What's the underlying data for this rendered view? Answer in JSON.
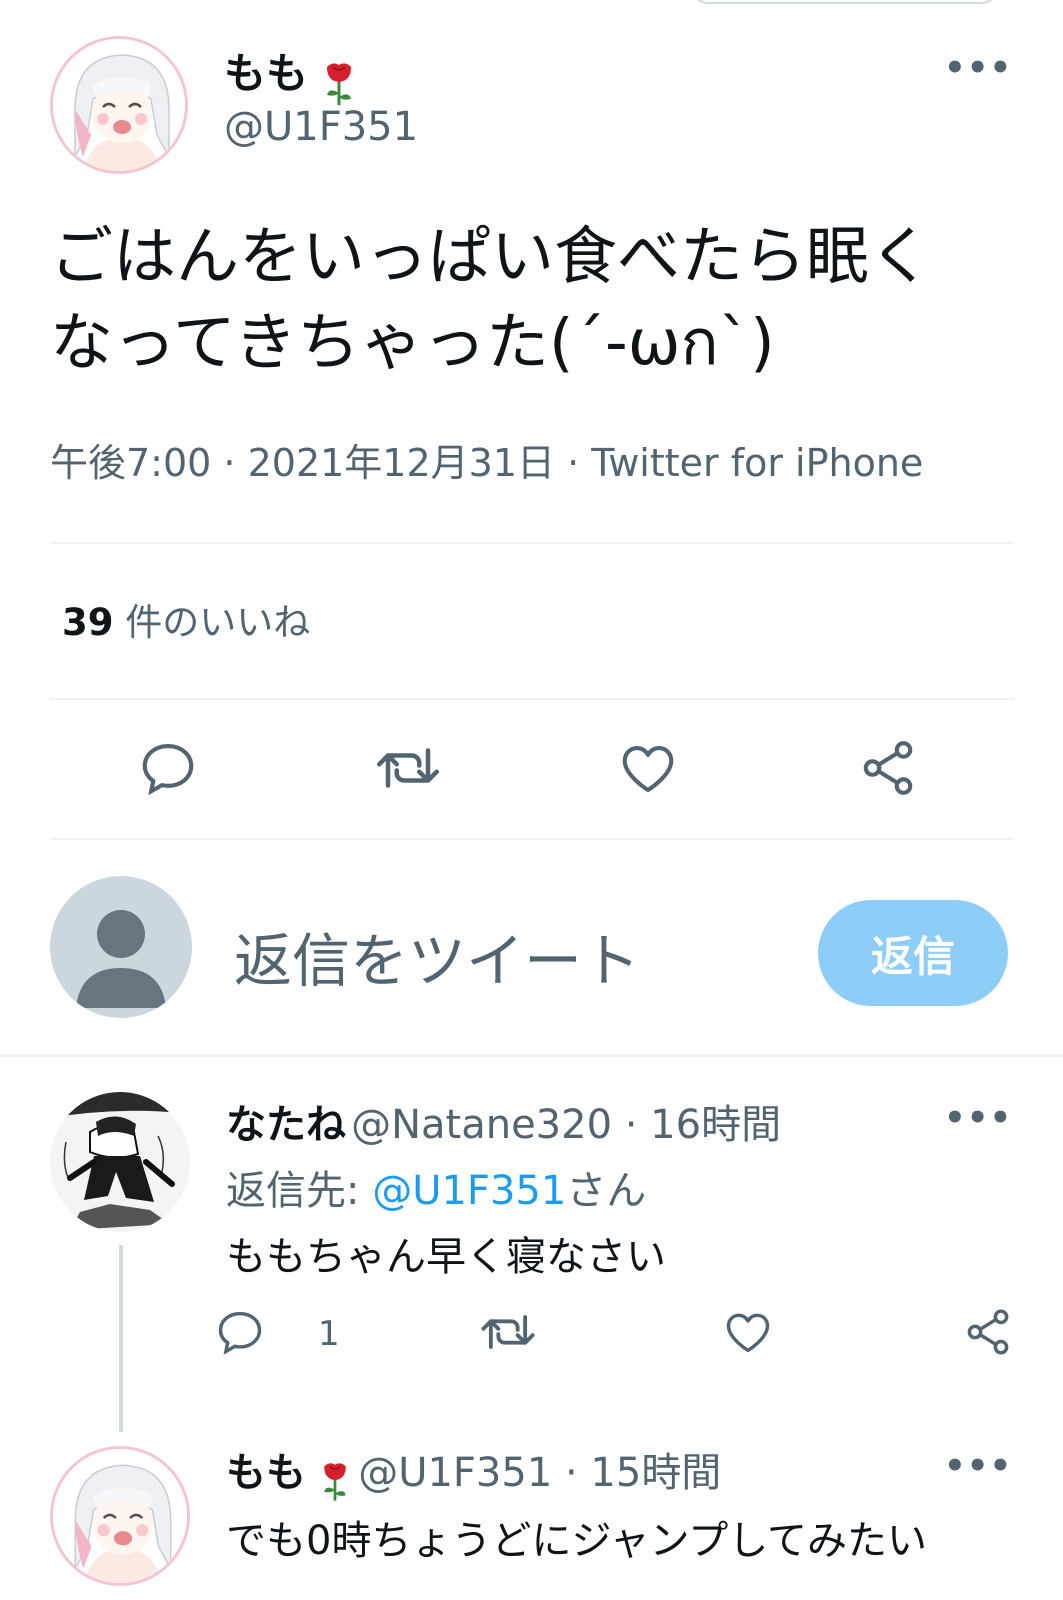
{
  "tweet": {
    "author_name": "もも",
    "author_handle": "@U1F351",
    "text_line1": "ごはんをいっぱい食べたら眠く",
    "text_line2": "なってきちゃった(´-ωก`)",
    "meta_time": "午後7:00",
    "meta_sep1": " · ",
    "meta_date": "2021年12月31日",
    "meta_sep2": " · ",
    "meta_source": "Twitter for iPhone",
    "likes_count": "39",
    "likes_label": " 件のいいね"
  },
  "composer": {
    "placeholder": "返信をツイート",
    "button_label": "返信"
  },
  "replies": [
    {
      "name": "なたね",
      "handle_and_time": "@Natane320 · 16時間",
      "reply_to_label": "返信先: ",
      "reply_to_handle": "@U1F351",
      "reply_to_suffix": "さん",
      "text": "ももちゃん早く寝なさい",
      "reply_count": "1"
    },
    {
      "name": "もも",
      "handle_and_time": "@U1F351 · 15時間",
      "text": "でも0時ちょうどにジャンプしてみたい"
    }
  ],
  "icons": {
    "more": "more-icon",
    "reply": "reply-icon",
    "retweet": "retweet-icon",
    "like": "like-icon",
    "share": "share-icon",
    "rose": "rose-emoji-icon"
  },
  "colors": {
    "accent": "#1d9bf0",
    "reply_button": "#8ecdf7",
    "secondary_text": "#536471",
    "divider": "#eff3f4"
  }
}
